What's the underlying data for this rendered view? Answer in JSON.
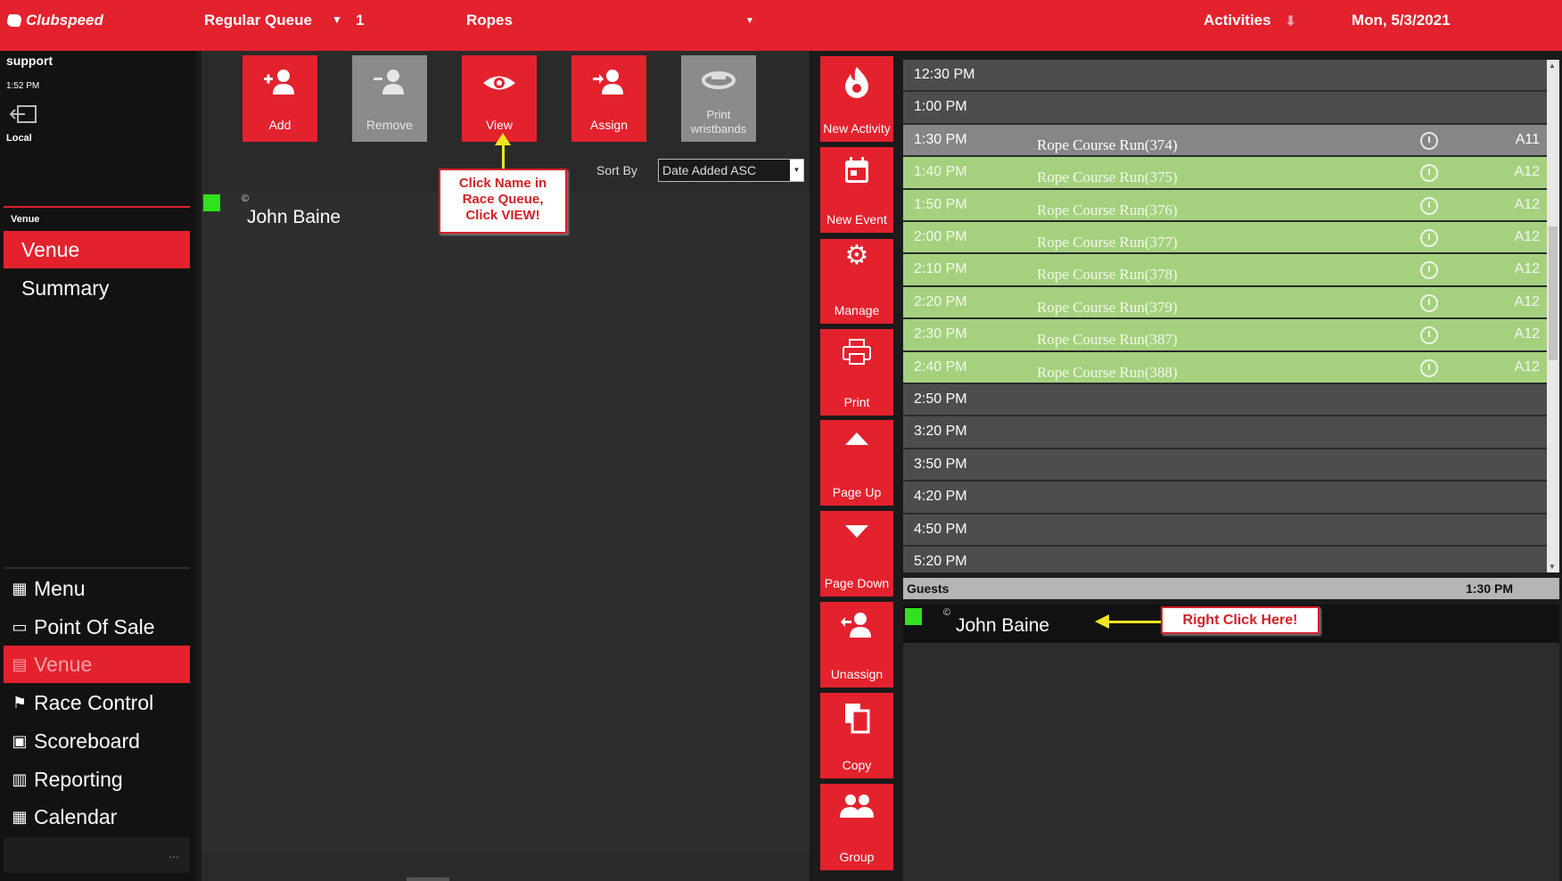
{
  "topbar": {
    "brand": "Clubspeed",
    "queue_label": "Regular Queue",
    "queue_count": "1",
    "activity_name": "Ropes",
    "activities_label": "Activities",
    "date": "Mon, 5/3/2021"
  },
  "user": {
    "name": "support",
    "time": "1:52 PM",
    "location": "Local"
  },
  "sidebar": {
    "section_title": "Venue",
    "sub_items": [
      "Venue",
      "Summary"
    ],
    "nav_items": [
      {
        "label": "Menu",
        "icon": "grid-icon"
      },
      {
        "label": "Point Of Sale",
        "icon": "card-icon"
      },
      {
        "label": "Venue",
        "icon": "store-icon"
      },
      {
        "label": "Race Control",
        "icon": "flag-icon"
      },
      {
        "label": "Scoreboard",
        "icon": "scoreboard-icon"
      },
      {
        "label": "Reporting",
        "icon": "chart-icon"
      },
      {
        "label": "Calendar",
        "icon": "calendar-icon"
      }
    ],
    "more": "..."
  },
  "toolbar": {
    "add": "Add",
    "remove": "Remove",
    "view": "View",
    "assign": "Assign",
    "print_line1": "Print",
    "print_line2": "wristbands",
    "sort_by_label": "Sort By",
    "sort_value": "Date Added ASC"
  },
  "queue": {
    "guest_name": "John Baine",
    "guest_mark": "©"
  },
  "callouts": {
    "view_line1": "Click Name in",
    "view_line2": "Race Queue,",
    "view_line3": "Click VIEW!",
    "right_click": "Right Click Here!"
  },
  "actions": [
    {
      "label": "New Activity",
      "icon": "flame-icon"
    },
    {
      "label": "New Event",
      "icon": "calendar-icon"
    },
    {
      "label": "Manage",
      "icon": "gear-icon"
    },
    {
      "label": "Print",
      "icon": "printer-icon"
    },
    {
      "label": "Page Up",
      "icon": "caret-up-icon"
    },
    {
      "label": "Page Down",
      "icon": "caret-down-icon"
    },
    {
      "label": "Unassign",
      "icon": "user-minus-icon"
    },
    {
      "label": "Copy",
      "icon": "copy-icon"
    },
    {
      "label": "Group",
      "icon": "group-icon"
    }
  ],
  "schedule": [
    {
      "time": "12:30 PM",
      "event": "",
      "code": "",
      "state": "plain"
    },
    {
      "time": "1:00 PM",
      "event": "",
      "code": "",
      "state": "plain"
    },
    {
      "time": "1:30 PM",
      "event": "Rope Course Run(374)",
      "code": "A11",
      "state": "selected"
    },
    {
      "time": "1:40 PM",
      "event": "Rope Course Run(375)",
      "code": "A12",
      "state": "green"
    },
    {
      "time": "1:50 PM",
      "event": "Rope Course Run(376)",
      "code": "A12",
      "state": "green"
    },
    {
      "time": "2:00 PM",
      "event": "Rope Course Run(377)",
      "code": "A12",
      "state": "green"
    },
    {
      "time": "2:10 PM",
      "event": "Rope Course Run(378)",
      "code": "A12",
      "state": "green"
    },
    {
      "time": "2:20 PM",
      "event": "Rope Course Run(379)",
      "code": "A12",
      "state": "green"
    },
    {
      "time": "2:30 PM",
      "event": "Rope Course Run(387)",
      "code": "A12",
      "state": "green"
    },
    {
      "time": "2:40 PM",
      "event": "Rope Course Run(388)",
      "code": "A12",
      "state": "green"
    },
    {
      "time": "2:50 PM",
      "event": "",
      "code": "",
      "state": "plain"
    },
    {
      "time": "3:20 PM",
      "event": "",
      "code": "",
      "state": "plain"
    },
    {
      "time": "3:50 PM",
      "event": "",
      "code": "",
      "state": "plain"
    },
    {
      "time": "4:20 PM",
      "event": "",
      "code": "",
      "state": "plain"
    },
    {
      "time": "4:50 PM",
      "event": "",
      "code": "",
      "state": "plain"
    },
    {
      "time": "5:20 PM",
      "event": "",
      "code": "",
      "state": "plain"
    }
  ],
  "guests": {
    "header": "Guests",
    "time": "1:30 PM",
    "guest_name": "John Baine",
    "guest_mark": "©"
  },
  "colors": {
    "accent": "#e3222e",
    "green_row": "#a5d17e",
    "status_green": "#31e21c",
    "arrow_yellow": "#f2e421"
  }
}
